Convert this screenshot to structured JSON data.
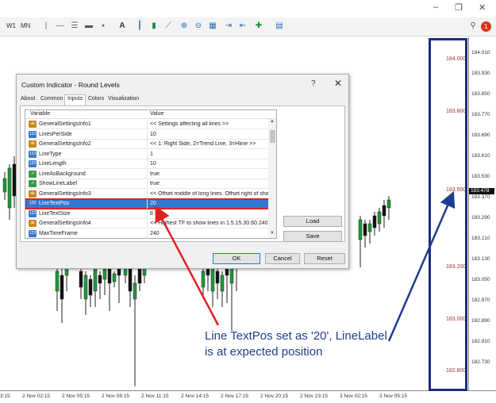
{
  "window": {
    "minimize_glyph": "–",
    "restore_glyph": "❐",
    "close_glyph": "✕",
    "mdi_controls": "_ ▫ ✕",
    "alert_badge": "1"
  },
  "toolbar": {
    "timeframes": [
      "W1",
      "MN"
    ],
    "icons": [
      "vertical-line-icon",
      "horizontal-line-icon",
      "trendline-icon",
      "channel-icon",
      "shapes-icon",
      "text-icon",
      "bar-chart-icon",
      "candle-chart-icon",
      "line-chart-icon",
      "zoom-in-icon",
      "zoom-out-icon",
      "tile-icon",
      "autoscroll-icon",
      "indicators-icon",
      "templates-icon",
      "search-icon"
    ]
  },
  "chart": {
    "price_ticks": [
      "184.010",
      "183.930",
      "183.850",
      "183.770",
      "183.690",
      "183.610",
      "183.530",
      "183.370",
      "183.290",
      "183.210",
      "183.130",
      "183.050",
      "182.970",
      "182.890",
      "182.810",
      "182.730"
    ],
    "current_price": "183.478",
    "level_labels": [
      "184.000",
      "183.800",
      "183.500",
      "183.200",
      "183.000",
      "182.800"
    ],
    "time_ticks": [
      "3:15",
      "2 Nov 02:15",
      "2 Nov 05:15",
      "2 Nov 08:15",
      "2 Nov 11:15",
      "2 Nov 14:15",
      "2 Nov 17:15",
      "2 Nov 20:15",
      "2 Nov 23:15",
      "3 Nov 02:15",
      "3 Nov 05:15"
    ],
    "highlight_color": "#1a2b7e",
    "level_color": "#9e3333"
  },
  "dialog": {
    "title": "Custom Indicator - Round Levels",
    "help": "?",
    "close": "✕",
    "tabs": [
      "About",
      "Common",
      "Inputs",
      "Colors",
      "Visualization"
    ],
    "active_tab": "Inputs",
    "columns": {
      "variable": "Variable",
      "value": "Value"
    },
    "rows": [
      {
        "icon": "ab",
        "name": "GeneralSettingsInfo1",
        "value": "<< Settings affecting all lines >>"
      },
      {
        "icon": "123",
        "name": "LinesPerSide",
        "value": "10"
      },
      {
        "icon": "ab",
        "name": "GeneralSettingsInfo2",
        "value": "<< 1: Right Side, 2=Trend Line, 3=Hline >>"
      },
      {
        "icon": "123",
        "name": "LineType",
        "value": "1"
      },
      {
        "icon": "123",
        "name": "LineLength",
        "value": "10"
      },
      {
        "icon": "bool",
        "name": "LineAsBackground",
        "value": "true"
      },
      {
        "icon": "bool",
        "name": "ShowLineLabel",
        "value": "true"
      },
      {
        "icon": "ab",
        "name": "GeneralSettingsInfo3",
        "value": "<< Offset middle of long lines. Offset right of sho..."
      },
      {
        "icon": "123",
        "name": "LineTextPos",
        "value": "20"
      },
      {
        "icon": "123",
        "name": "LineTextSize",
        "value": "8"
      },
      {
        "icon": "ab",
        "name": "GeneralSettingsInfo4",
        "value": "<< Highest TF to show lines in 1.5.15.30.60.240..."
      },
      {
        "icon": "123",
        "name": "MaxTimeFrame",
        "value": "240"
      }
    ],
    "selected_row": "LineTextPos",
    "buttons": {
      "load": "Load",
      "save": "Save",
      "ok": "OK",
      "cancel": "Cancel",
      "reset": "Reset"
    },
    "scroll_up": "▲",
    "scroll_down": "▼"
  },
  "annotation": {
    "line1": "Line TextPos set as '20', LineLabel",
    "line2": "is at expected position",
    "arrow_color_red": "#e02020",
    "arrow_color_blue": "#1f3d8e"
  }
}
